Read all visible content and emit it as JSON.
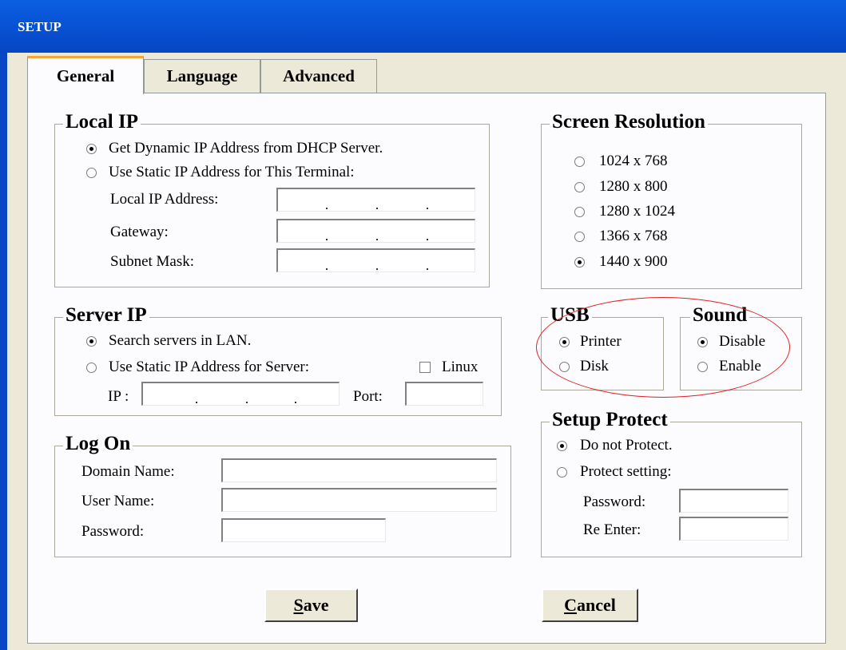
{
  "window": {
    "title": "SETUP"
  },
  "tabs": [
    "General",
    "Language",
    "Advanced"
  ],
  "local_ip": {
    "legend": "Local IP",
    "dhcp": "Get Dynamic IP Address from DHCP Server.",
    "static": "Use Static IP Address for This Terminal:",
    "local_ip_label": "Local IP Address:",
    "gateway_label": "Gateway:",
    "subnet_label": "Subnet Mask:",
    "selected": "dhcp"
  },
  "server_ip": {
    "legend": "Server IP",
    "search": "Search servers in LAN.",
    "static": "Use Static IP Address for Server:",
    "linux": "Linux",
    "ip_label": "IP :",
    "port_label": "Port:",
    "selected": "search"
  },
  "log_on": {
    "legend": "Log On",
    "domain_label": "Domain Name:",
    "user_label": "User Name:",
    "password_label": "Password:"
  },
  "screen_resolution": {
    "legend": "Screen Resolution",
    "options": [
      "1024 x 768",
      "1280 x 800",
      "1280 x 1024",
      "1366 x 768",
      "1440 x 900"
    ],
    "selected": "1440 x 900"
  },
  "usb": {
    "legend": "USB",
    "printer": "Printer",
    "disk": "Disk",
    "selected": "Printer"
  },
  "sound": {
    "legend": "Sound",
    "disable": "Disable",
    "enable": "Enable",
    "selected": "Disable"
  },
  "setup_protect": {
    "legend": "Setup Protect",
    "no_protect": "Do not Protect.",
    "protect": "Protect setting:",
    "password_label": "Password:",
    "reenter_label": "Re Enter:",
    "selected": "Do not Protect."
  },
  "buttons": {
    "save_mnemonic": "S",
    "save_rest": "ave",
    "cancel_mnemonic": "C",
    "cancel_rest": "ancel"
  },
  "colors": {
    "titlebar": "#0553d6",
    "tab_highlight": "#f2a63b",
    "annotation_circle": "#e02020"
  }
}
